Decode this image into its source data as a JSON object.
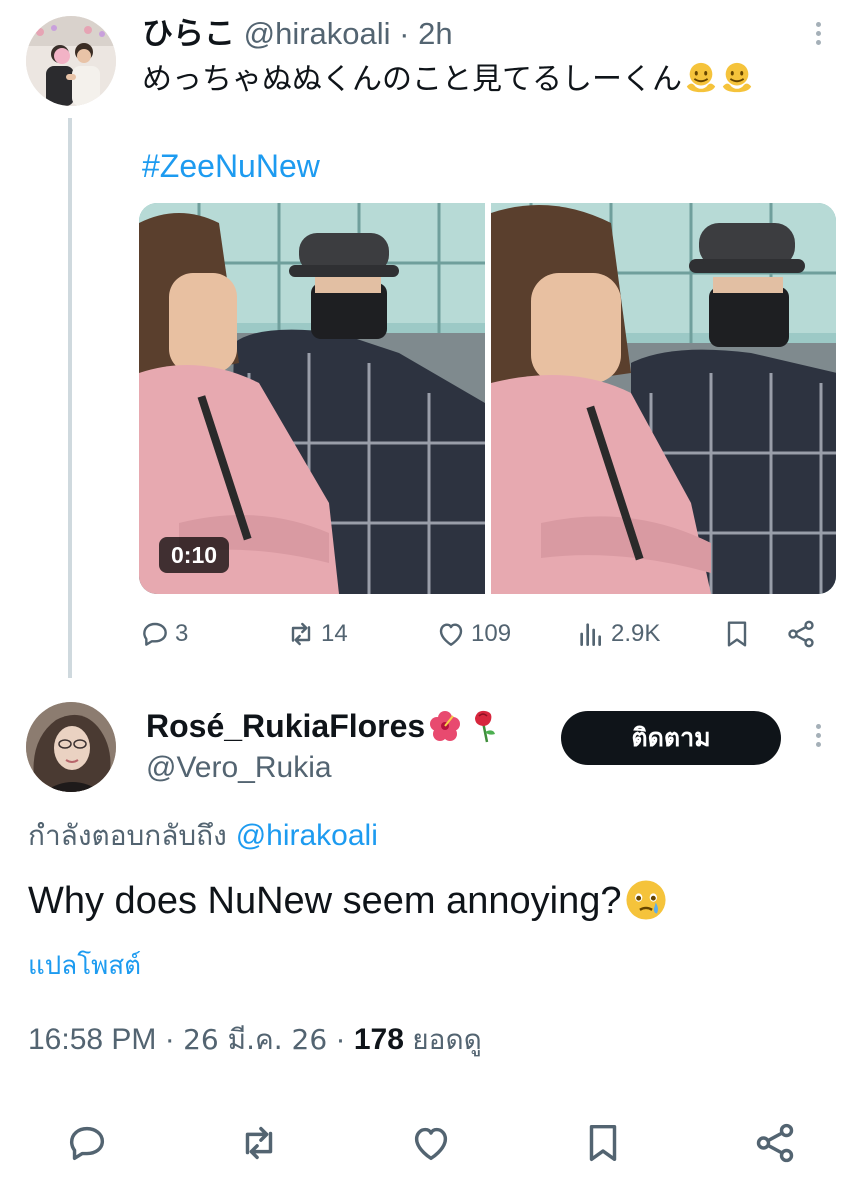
{
  "tweet1": {
    "display_name": "ひらこ",
    "handle": "@hirakoali",
    "separator": "·",
    "time": "2h",
    "text": "めっちゃぬぬくんのこと見てるしーくん",
    "hashtag": "#ZeeNuNew",
    "video_duration": "0:10",
    "stats": {
      "replies": "3",
      "reposts": "14",
      "likes": "109",
      "views": "2.9K"
    }
  },
  "tweet2": {
    "display_name": "Rosé_RukiaFlores",
    "handle": "@Vero_Rukia",
    "follow_label": "ติดตาม",
    "reply_prefix": "กำลังตอบกลับถึง",
    "reply_to": "@hirakoali",
    "text": "Why does NuNew seem annoying?",
    "translate_label": "แปลโพสต์",
    "time": "16:58 PM",
    "sep1": "·",
    "date": "26 มี.ค. 26",
    "sep2": "·",
    "views_count": "178",
    "views_label": "ยอดดู"
  },
  "icons": {
    "reply": "reply-icon",
    "repost": "repost-icon",
    "like": "heart-icon",
    "views": "views-icon",
    "bookmark": "bookmark-icon",
    "share": "share-icon",
    "more": "more-vertical-icon"
  },
  "colors": {
    "link": "#1d9bf0",
    "secondary": "#536471",
    "primary": "#0f1419",
    "thread_line": "#cfd9de"
  }
}
